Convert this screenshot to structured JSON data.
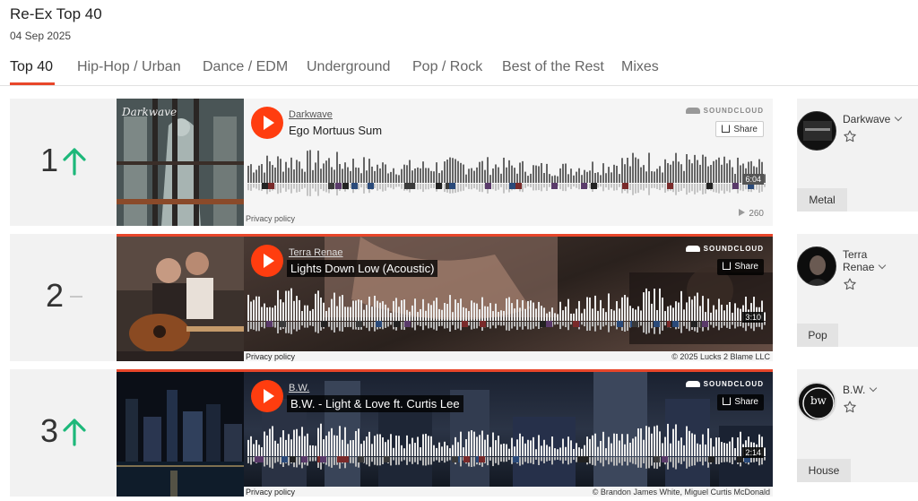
{
  "page": {
    "title": "Re-Ex Top 40",
    "date": "04 Sep 2025"
  },
  "tabs": [
    {
      "label": "Top 40",
      "active": true
    },
    {
      "label": "Hip-Hop / Urban"
    },
    {
      "label": "Dance / EDM"
    },
    {
      "label": "Underground"
    },
    {
      "label": "Pop / Rock"
    },
    {
      "label": "Best of the Rest"
    },
    {
      "label": "Mixes"
    }
  ],
  "accent_color": "#e8462a",
  "trend_up_color": "#1db87a",
  "player_common": {
    "soundcloud_label": "SOUNDCLOUD",
    "share_label": "Share",
    "privacy_label": "Privacy policy"
  },
  "entries": [
    {
      "rank": "1",
      "trend": "up",
      "artist": "Darkwave",
      "track": "Ego Mortuus Sum",
      "duration": "6:04",
      "plays": "260",
      "copyright": "",
      "art_text": "Darkwave",
      "genre": "Metal",
      "theme": "light"
    },
    {
      "rank": "2",
      "trend": "same",
      "artist": "Terra Renae",
      "track": "Lights Down Low (Acoustic)",
      "duration": "3:10",
      "plays": "",
      "copyright": "© 2025 Lucks 2 Blame LLC",
      "genre": "Pop",
      "theme": "dark"
    },
    {
      "rank": "3",
      "trend": "up",
      "artist": "B.W.",
      "track": "B.W. - Light & Love ft. Curtis Lee",
      "duration": "2:14",
      "plays": "",
      "copyright": "© Brandon James White, Miguel Curtis McDonald",
      "avatar_text": "b w",
      "genre": "House",
      "theme": "city"
    }
  ]
}
